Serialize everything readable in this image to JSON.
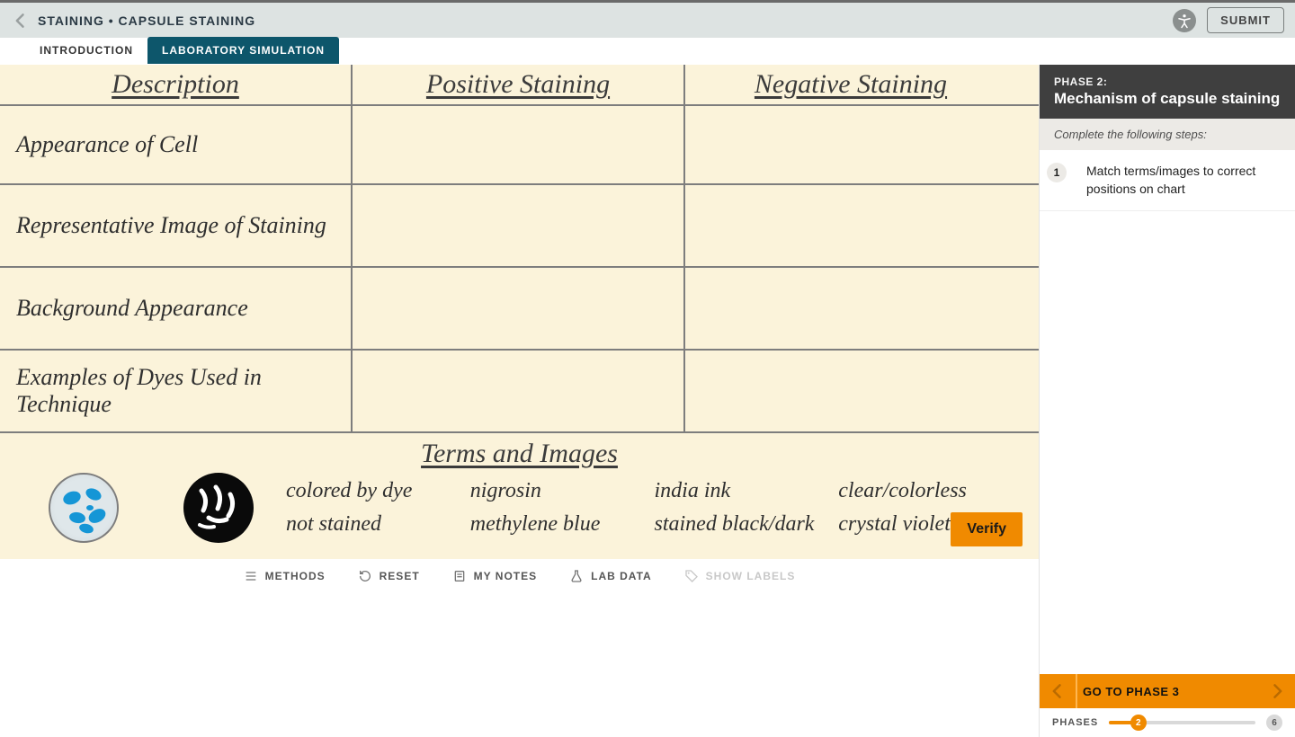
{
  "header": {
    "breadcrumb": "STAINING • CAPSULE STAINING",
    "submit": "SUBMIT"
  },
  "tabs": {
    "introduction": "INTRODUCTION",
    "simulation": "LABORATORY SIMULATION"
  },
  "chart": {
    "headers": {
      "description": "Description",
      "positive": "Positive Staining",
      "negative": "Negative Staining"
    },
    "rows": {
      "r1": "Appearance of Cell",
      "r2": "Representative Image of Staining",
      "r3": "Background Appearance",
      "r4": "Examples of Dyes Used in Technique"
    }
  },
  "terms": {
    "title": "Terms and Images",
    "c1a": "colored by dye",
    "c1b": "not stained",
    "c2a": "nigrosin",
    "c2b": "methylene blue",
    "c3a": "india ink",
    "c3b": "stained black/dark",
    "c4a": "clear/colorless",
    "c4b": "crystal violet",
    "verify": "Verify"
  },
  "toolbar": {
    "methods": "METHODS",
    "reset": "RESET",
    "mynotes": "MY NOTES",
    "labdata": "LAB DATA",
    "showlabels": "SHOW LABELS"
  },
  "sidebar": {
    "kicker": "PHASE 2:",
    "title": "Mechanism of capsule staining",
    "instruction": "Complete the following steps:",
    "step_num": "1",
    "step_text": "Match terms/images to correct positions on chart",
    "nav_label": "GO TO PHASE 3",
    "slider_label": "PHASES",
    "current": "2",
    "total": "6"
  }
}
